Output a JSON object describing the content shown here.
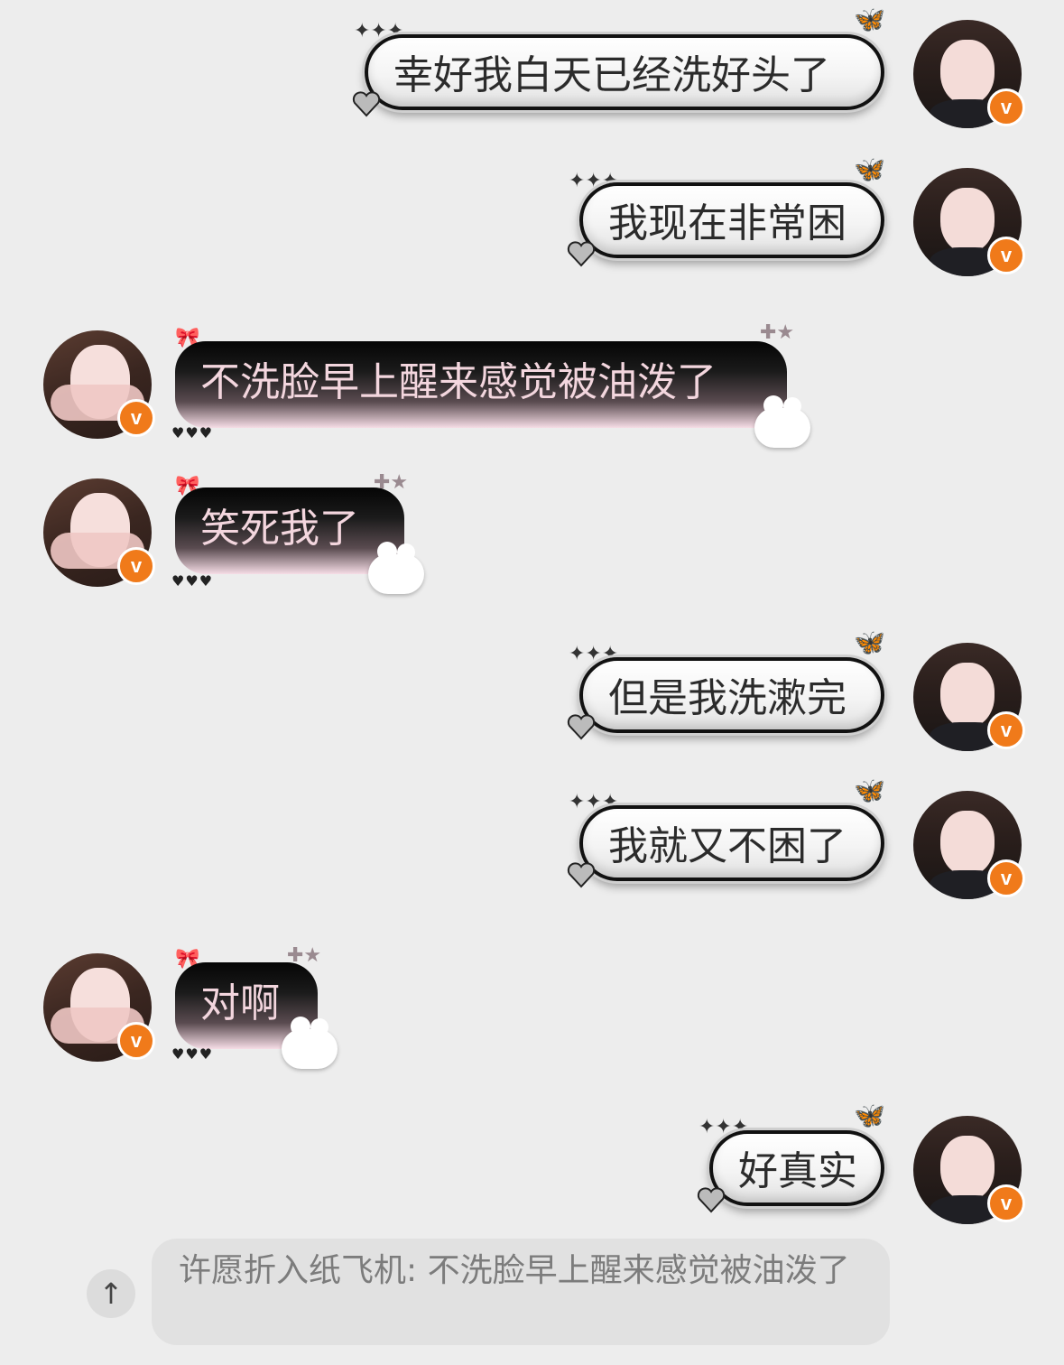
{
  "messages": [
    {
      "side": "sent",
      "text": "幸好我白天已经洗好头了"
    },
    {
      "side": "sent",
      "text": "我现在非常困"
    },
    {
      "side": "received",
      "text": "不洗脸早上醒来感觉被油泼了"
    },
    {
      "side": "received",
      "text": "笑死我了"
    },
    {
      "side": "sent",
      "text": "但是我洗漱完"
    },
    {
      "side": "sent",
      "text": "我就又不困了"
    },
    {
      "side": "received",
      "text": "对啊"
    },
    {
      "side": "sent",
      "text": "好真实"
    }
  ],
  "badge_label": "v",
  "quote": {
    "text": "许愿折入纸飞机: 不洗脸早上醒来感觉被油泼了"
  },
  "scroll_top_icon": "↑",
  "colors": {
    "background": "#ededed",
    "badge": "#f07a1a",
    "received_text": "#f3d6de"
  }
}
